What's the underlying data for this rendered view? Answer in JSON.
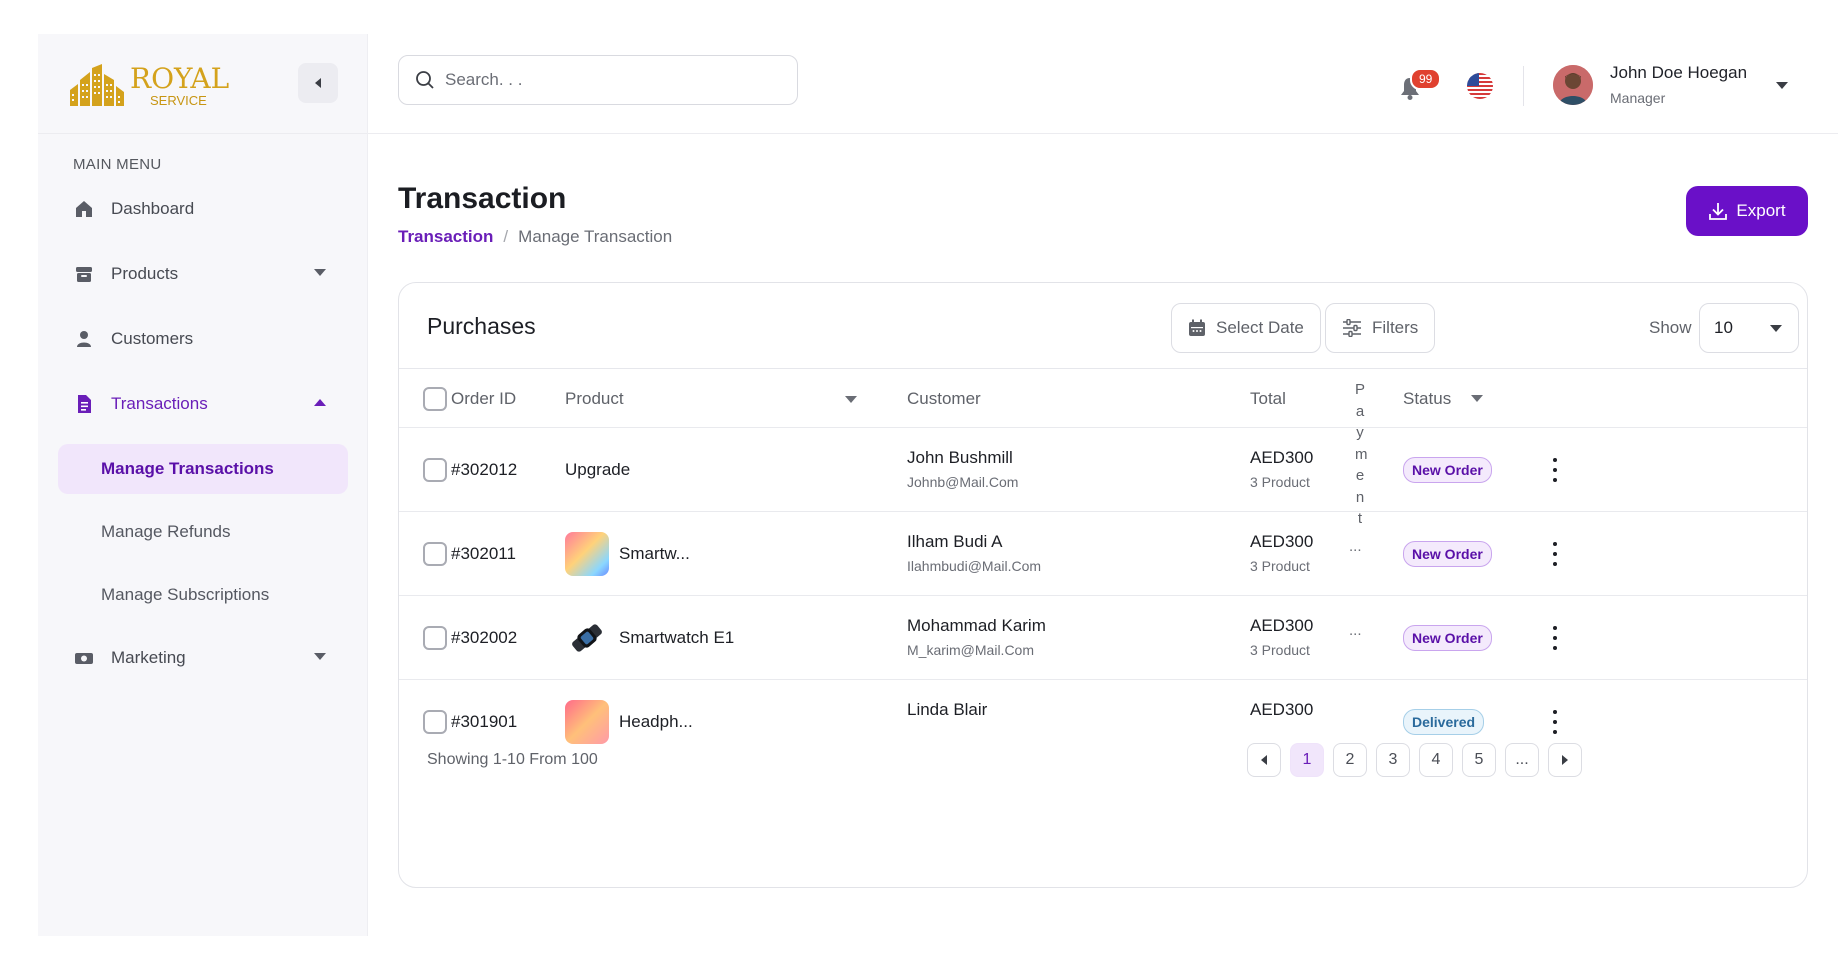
{
  "brand": {
    "line1": "ROYAL",
    "line2": "SERVICE",
    "color": "#d4a21c"
  },
  "sidebar": {
    "menu_label": "MAIN MENU",
    "items": [
      {
        "label": "Dashboard",
        "icon": "home-icon"
      },
      {
        "label": "Products",
        "icon": "archive-icon"
      },
      {
        "label": "Customers",
        "icon": "user-icon"
      },
      {
        "label": "Transactions",
        "icon": "document-icon"
      },
      {
        "label": "Marketing",
        "icon": "money-icon"
      }
    ],
    "sub_items": [
      "Manage Transactions",
      "Manage Refunds",
      "Manage Subscriptions"
    ],
    "active_sub": "Manage Transactions"
  },
  "topbar": {
    "search_placeholder": "Search. . .",
    "notification_count": "99",
    "user_name": "John Doe Hoegan",
    "user_role": "Manager"
  },
  "page": {
    "title": "Transaction",
    "breadcrumb": [
      "Transaction",
      "/",
      "Manage Transaction"
    ],
    "export_label": "Export",
    "accent": "#6a10c8"
  },
  "card": {
    "title": "Purchases",
    "select_date": "Select Date",
    "filters": "Filters",
    "show_label": "Show",
    "show_value": "10"
  },
  "table": {
    "headers": {
      "order_id": "Order ID",
      "product": "Product",
      "customer": "Customer",
      "total": "Total",
      "payment": "Payment",
      "status": "Status"
    },
    "rows": [
      {
        "id": "#302012",
        "product": "Upgrade",
        "customer": "John Bushmill",
        "email": "Johnb@Mail.Com",
        "total": "AED300",
        "qty": "3 Product",
        "payment": "",
        "status": "New Order"
      },
      {
        "id": "#302011",
        "product": "Smartw...",
        "customer": "Ilham Budi A",
        "email": "Ilahmbudi@Mail.Com",
        "total": "AED300",
        "qty": "3 Product",
        "payment": "...",
        "status": "New Order"
      },
      {
        "id": "#302002",
        "product": "Smartwatch E1",
        "customer": "Mohammad Karim",
        "email": "M_karim@Mail.Com",
        "total": "AED300",
        "qty": "3 Product",
        "payment": "...",
        "status": "New Order"
      },
      {
        "id": "#301901",
        "product": "Headph...",
        "customer": "Linda Blair",
        "email": "",
        "total": "AED300",
        "qty": "",
        "payment": "",
        "status": "Delivered"
      }
    ]
  },
  "footer": {
    "showing": "Showing 1-10 From 100",
    "pages": [
      "1",
      "2",
      "3",
      "4",
      "5",
      "..."
    ]
  }
}
